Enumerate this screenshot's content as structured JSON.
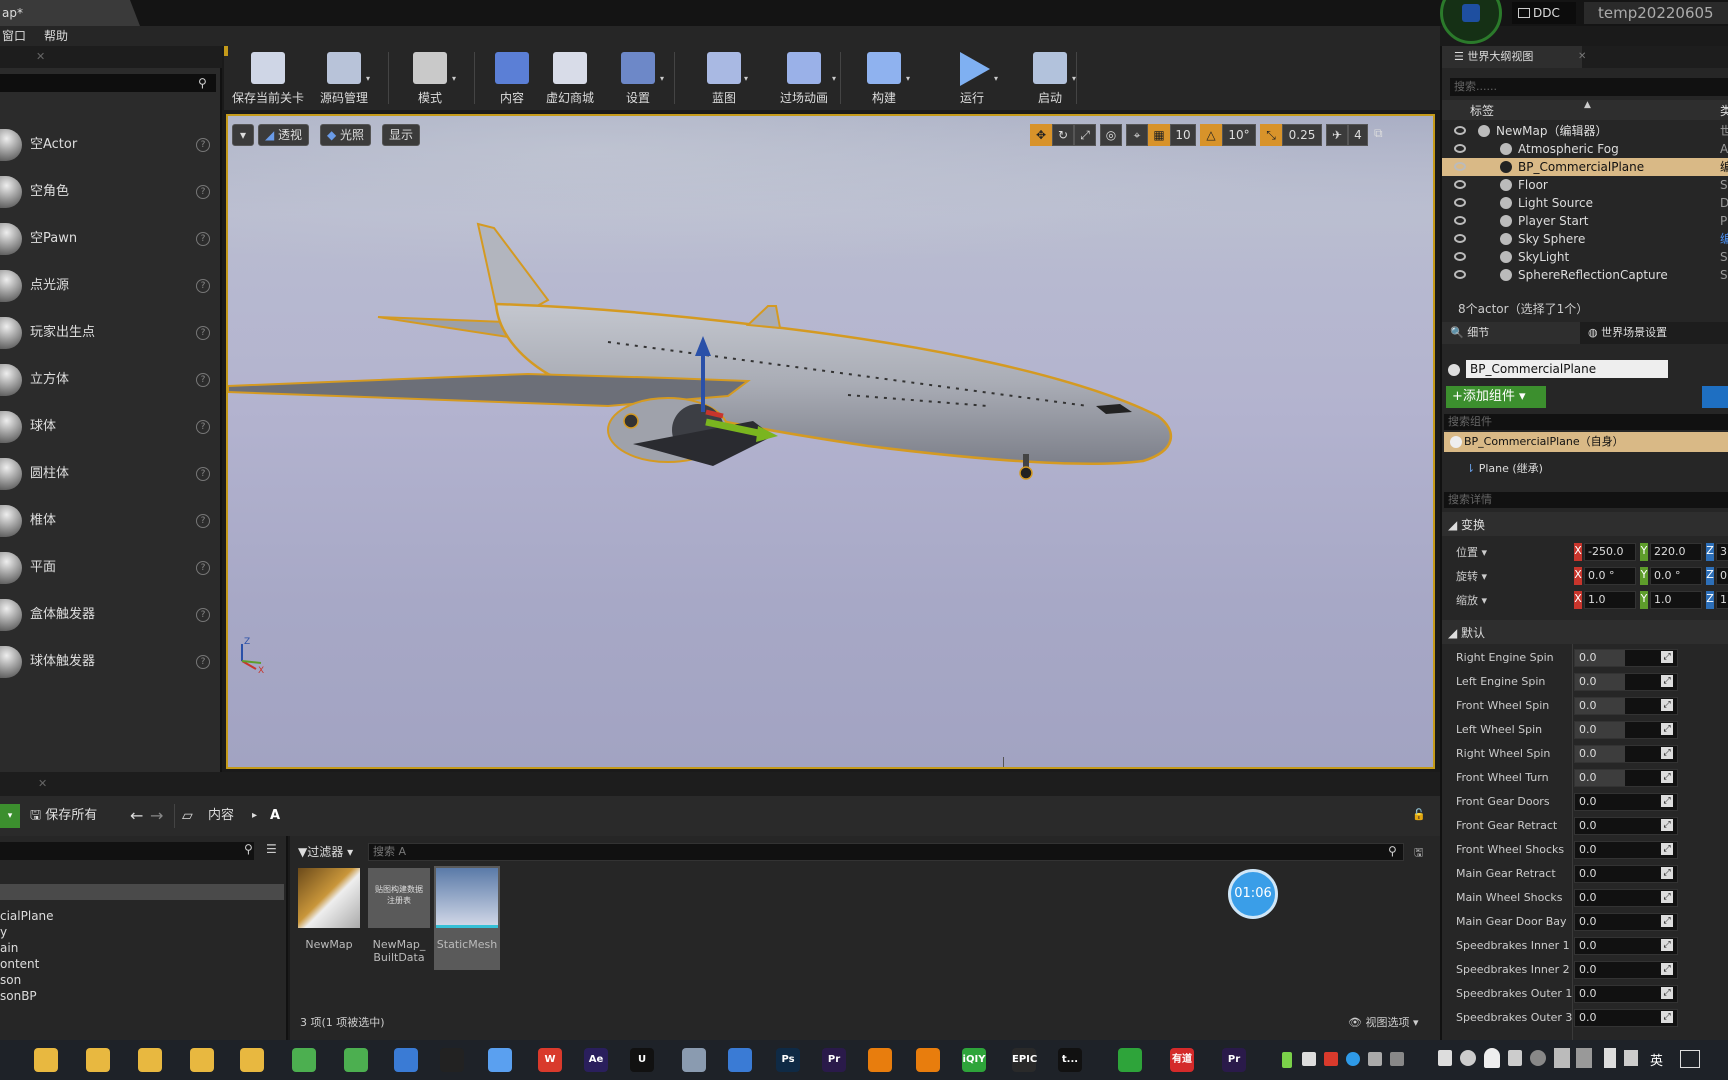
{
  "title_bar": {
    "tab_title": "ap*",
    "ddc_label": "DDC",
    "project_name": "temp20220605"
  },
  "menu": {
    "items": [
      "窗口",
      "帮助"
    ]
  },
  "place_actors": {
    "items": [
      {
        "label": "空Actor"
      },
      {
        "label": "空角色"
      },
      {
        "label": "空Pawn"
      },
      {
        "label": "点光源"
      },
      {
        "label": "玩家出生点"
      },
      {
        "label": "立方体"
      },
      {
        "label": "球体"
      },
      {
        "label": "圆柱体"
      },
      {
        "label": "椎体"
      },
      {
        "label": "平面"
      },
      {
        "label": "盒体触发器"
      },
      {
        "label": "球体触发器"
      }
    ],
    "help_glyph": "?"
  },
  "toolbar": {
    "buttons": [
      {
        "label": "保存当前关卡",
        "icon": "save-icon",
        "color": "#cfd6e6"
      },
      {
        "label": "源码管理",
        "icon": "source-control-icon",
        "color": "#b8c3d9"
      },
      {
        "label": "模式",
        "icon": "modes-icon",
        "color": "#c9c9c9"
      },
      {
        "label": "内容",
        "icon": "content-icon",
        "color": "#5b7fd6"
      },
      {
        "label": "虚幻商城",
        "icon": "marketplace-icon",
        "color": "#d8dce8"
      },
      {
        "label": "设置",
        "icon": "settings-icon",
        "color": "#6d88c8"
      },
      {
        "label": "蓝图",
        "icon": "blueprint-icon",
        "color": "#a9b9e3"
      },
      {
        "label": "过场动画",
        "icon": "cinematics-icon",
        "color": "#9ab1e8"
      },
      {
        "label": "构建",
        "icon": "build-icon",
        "color": "#8fb2ef"
      },
      {
        "label": "运行",
        "icon": "play-icon",
        "color": "#7fb0f2"
      },
      {
        "label": "启动",
        "icon": "launch-icon",
        "color": "#b2c2dc"
      }
    ]
  },
  "viewport": {
    "perspective_label": "透视",
    "lit_label": "光照",
    "show_label": "显示",
    "grid_snap": "10",
    "rotation_snap": "10°",
    "scale_snap": "0.25",
    "camera_speed": "4",
    "accent_color": "#d8932a",
    "axis_labels": {
      "z": "Z",
      "x": "X"
    }
  },
  "content_browser": {
    "save_all_label": "保存所有",
    "breadcrumb": [
      "内容",
      "A"
    ],
    "filter_label": "过滤器",
    "search_placeholder": "搜索 A",
    "folders": [
      "cialPlane",
      "y",
      "ain",
      "ontent",
      "son",
      "sonBP"
    ],
    "assets": [
      {
        "label": "NewMap",
        "thumb_text": ""
      },
      {
        "label": "NewMap_\nBuiltData",
        "thumb_text": "贴图构建数据\n注册表"
      },
      {
        "label": "StaticMesh",
        "thumb_text": ""
      }
    ],
    "status": "3 项(1 项被选中)",
    "view_options": "视图选项"
  },
  "timer": "01:06",
  "outliner": {
    "tab_label": "世界大纲视图",
    "search_placeholder": "搜索......",
    "column_label": "标签",
    "column_type": "类",
    "rows": [
      {
        "label": "NewMap（编辑器）",
        "type": "世"
      },
      {
        "label": "Atmospheric Fog",
        "type": "At"
      },
      {
        "label": "BP_CommercialPlane",
        "type": "编"
      },
      {
        "label": "Floor",
        "type": "St"
      },
      {
        "label": "Light Source",
        "type": "Di"
      },
      {
        "label": "Player Start",
        "type": "Pl"
      },
      {
        "label": "Sky Sphere",
        "type": "编"
      },
      {
        "label": "SkyLight",
        "type": "Sk"
      },
      {
        "label": "SphereReflectionCapture",
        "type": "Sp"
      }
    ],
    "footer": "8个actor（选择了1个）"
  },
  "details": {
    "tab_details": "细节",
    "tab_world": "世界场景设置",
    "actor_name": "BP_CommercialPlane",
    "add_component": "添加组件",
    "search_components": "搜索组件",
    "self_component": "BP_CommercialPlane（自身）",
    "child_component": "Plane (继承)",
    "search_details": "搜索详情",
    "transform_header": "变换",
    "transform": [
      {
        "label": "位置",
        "x": "-250.0",
        "y": "220.0",
        "z": "3"
      },
      {
        "label": "旋转",
        "x": "0.0 °",
        "y": "0.0 °",
        "z": "0"
      },
      {
        "label": "缩放",
        "x": "1.0",
        "y": "1.0",
        "z": "1"
      }
    ],
    "default_header": "默认",
    "properties": [
      {
        "label": "Right Engine Spin",
        "value": "0.0"
      },
      {
        "label": "Left Engine Spin",
        "value": "0.0"
      },
      {
        "label": "Front Wheel Spin",
        "value": "0.0"
      },
      {
        "label": "Left Wheel Spin",
        "value": "0.0"
      },
      {
        "label": "Right Wheel Spin",
        "value": "0.0"
      },
      {
        "label": "Front Wheel Turn",
        "value": "0.0"
      },
      {
        "label": "Front Gear Doors",
        "value": "0.0"
      },
      {
        "label": "Front Gear Retract",
        "value": "0.0"
      },
      {
        "label": "Front Wheel Shocks",
        "value": "0.0"
      },
      {
        "label": "Main Gear Retract",
        "value": "0.0"
      },
      {
        "label": "Main Wheel Shocks",
        "value": "0.0"
      },
      {
        "label": "Main Gear Door Bay",
        "value": "0.0"
      },
      {
        "label": "Speedbrakes Inner 1",
        "value": "0.0"
      },
      {
        "label": "Speedbrakes Inner 2",
        "value": "0.0"
      },
      {
        "label": "Speedbrakes Outer 1",
        "value": "0.0"
      },
      {
        "label": "Speedbrakes Outer 3",
        "value": "0.0"
      }
    ],
    "colors": {
      "x": "#c8352c",
      "y": "#5e9d2b",
      "z": "#2d6fb8",
      "add": "#3c8f2e"
    }
  },
  "taskbar": {
    "apps": [
      {
        "icon": "folder-icon",
        "text": "",
        "color": "#e8b840"
      },
      {
        "icon": "folder-icon",
        "text": "",
        "color": "#e8b840"
      },
      {
        "icon": "folder-icon",
        "text": "",
        "color": "#e8b840"
      },
      {
        "icon": "folder-icon",
        "text": "",
        "color": "#e8b840"
      },
      {
        "icon": "folder-icon",
        "text": "",
        "color": "#e8b840"
      },
      {
        "icon": "browser-icon",
        "text": "",
        "color": "#4caf50"
      },
      {
        "icon": "browser-icon",
        "text": "",
        "color": "#4caf50"
      },
      {
        "icon": "tiles-icon",
        "text": "",
        "color": "#3a7bd5"
      },
      {
        "icon": "qq-icon",
        "text": "",
        "color": "#222"
      },
      {
        "icon": "cloud-icon",
        "text": "",
        "color": "#5aa0f0"
      },
      {
        "icon": "wps-icon",
        "text": "W",
        "color": "#d93a2c"
      },
      {
        "icon": "after-effects-icon",
        "text": "Ae",
        "color": "#2a1f5c"
      },
      {
        "icon": "unreal-icon",
        "text": "U",
        "color": "#111"
      },
      {
        "icon": "monitor-icon",
        "text": "",
        "color": "#8a9bb0"
      },
      {
        "icon": "window-icon",
        "text": "",
        "color": "#3a7bd5"
      },
      {
        "icon": "photoshop-icon",
        "text": "Ps",
        "color": "#0f2a45"
      },
      {
        "icon": "premiere-icon",
        "text": "Pr",
        "color": "#2a1a4a"
      },
      {
        "icon": "blender-icon",
        "text": "",
        "color": "#e87d0d"
      },
      {
        "icon": "blender-icon",
        "text": "",
        "color": "#e87d0d"
      },
      {
        "icon": "iqiyi-icon",
        "text": "iQIY",
        "color": "#2ea43a"
      },
      {
        "icon": "epic-icon",
        "text": "EPIC",
        "color": "#2a2a2a"
      },
      {
        "icon": "unreal-icon",
        "text": "t...",
        "color": "#111"
      },
      {
        "icon": "media-icon",
        "text": "",
        "color": "#2ea43a"
      },
      {
        "icon": "youdao-icon",
        "text": "有道",
        "color": "#d42a2a"
      },
      {
        "icon": "premiere-icon",
        "text": "Pr",
        "color": "#2a1a4a"
      }
    ],
    "ime_label": "英"
  }
}
